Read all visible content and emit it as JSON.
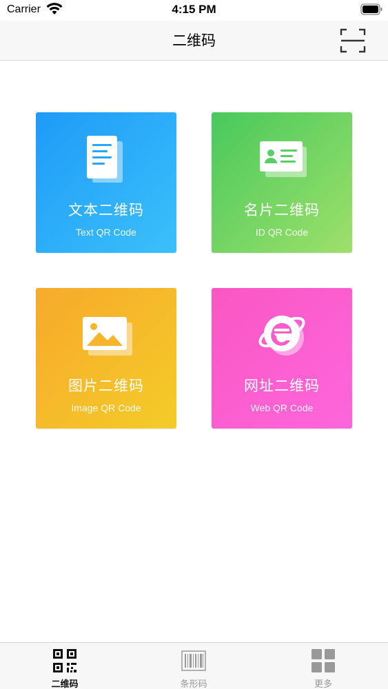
{
  "status_bar": {
    "carrier": "Carrier",
    "time": "4:15 PM"
  },
  "nav": {
    "title": "二维码",
    "scan_icon": "scan-frame-icon"
  },
  "tiles": [
    {
      "title": "文本二维码",
      "subtitle": "Text QR Code",
      "icon": "document-icon",
      "colors": [
        "#1e9bf7",
        "#3cc0fb"
      ]
    },
    {
      "title": "名片二维码",
      "subtitle": "ID QR Code",
      "icon": "id-card-icon",
      "colors": [
        "#48c95c",
        "#9ee06a"
      ]
    },
    {
      "title": "图片二维码",
      "subtitle": "Image QR Code",
      "icon": "image-icon",
      "colors": [
        "#f8a92c",
        "#f3cc28"
      ]
    },
    {
      "title": "网址二维码",
      "subtitle": "Web QR Code",
      "icon": "browser-icon",
      "colors": [
        "#f957c3",
        "#ff66dc"
      ]
    }
  ],
  "tab_bar": {
    "tabs": [
      {
        "label": "二维码",
        "icon": "qr-code-icon",
        "selected": true
      },
      {
        "label": "条形码",
        "icon": "barcode-icon",
        "selected": false
      },
      {
        "label": "更多",
        "icon": "grid-icon",
        "selected": false
      }
    ]
  }
}
